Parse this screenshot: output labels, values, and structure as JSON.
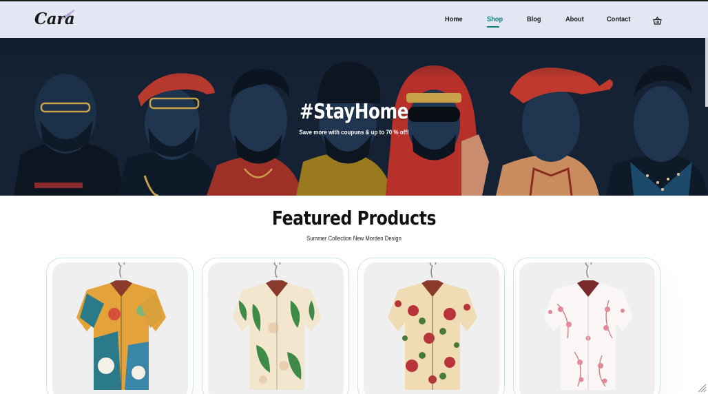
{
  "header": {
    "logo_text": "Cara",
    "nav": [
      {
        "label": "Home",
        "active": false
      },
      {
        "label": "Shop",
        "active": true
      },
      {
        "label": "Blog",
        "active": false
      },
      {
        "label": "About",
        "active": false
      },
      {
        "label": "Contact",
        "active": false
      }
    ],
    "cart_icon": "shopping-basket-icon"
  },
  "hero": {
    "title": "#StayHome",
    "subtitle": "Save more with coupuns & up to 70 % off!"
  },
  "featured": {
    "title": "Featured Products",
    "subtitle": "Summer Collection New Morden Design"
  },
  "products": [
    {
      "image": "abstract-print-shirt"
    },
    {
      "image": "tropical-leaf-shirt"
    },
    {
      "image": "floral-rose-shirt"
    },
    {
      "image": "pink-blossom-shirt"
    }
  ],
  "colors": {
    "accent": "#088178",
    "header_bg": "#e3e6f3",
    "hero_bg": "#142234",
    "card_border": "#cce7d0"
  }
}
